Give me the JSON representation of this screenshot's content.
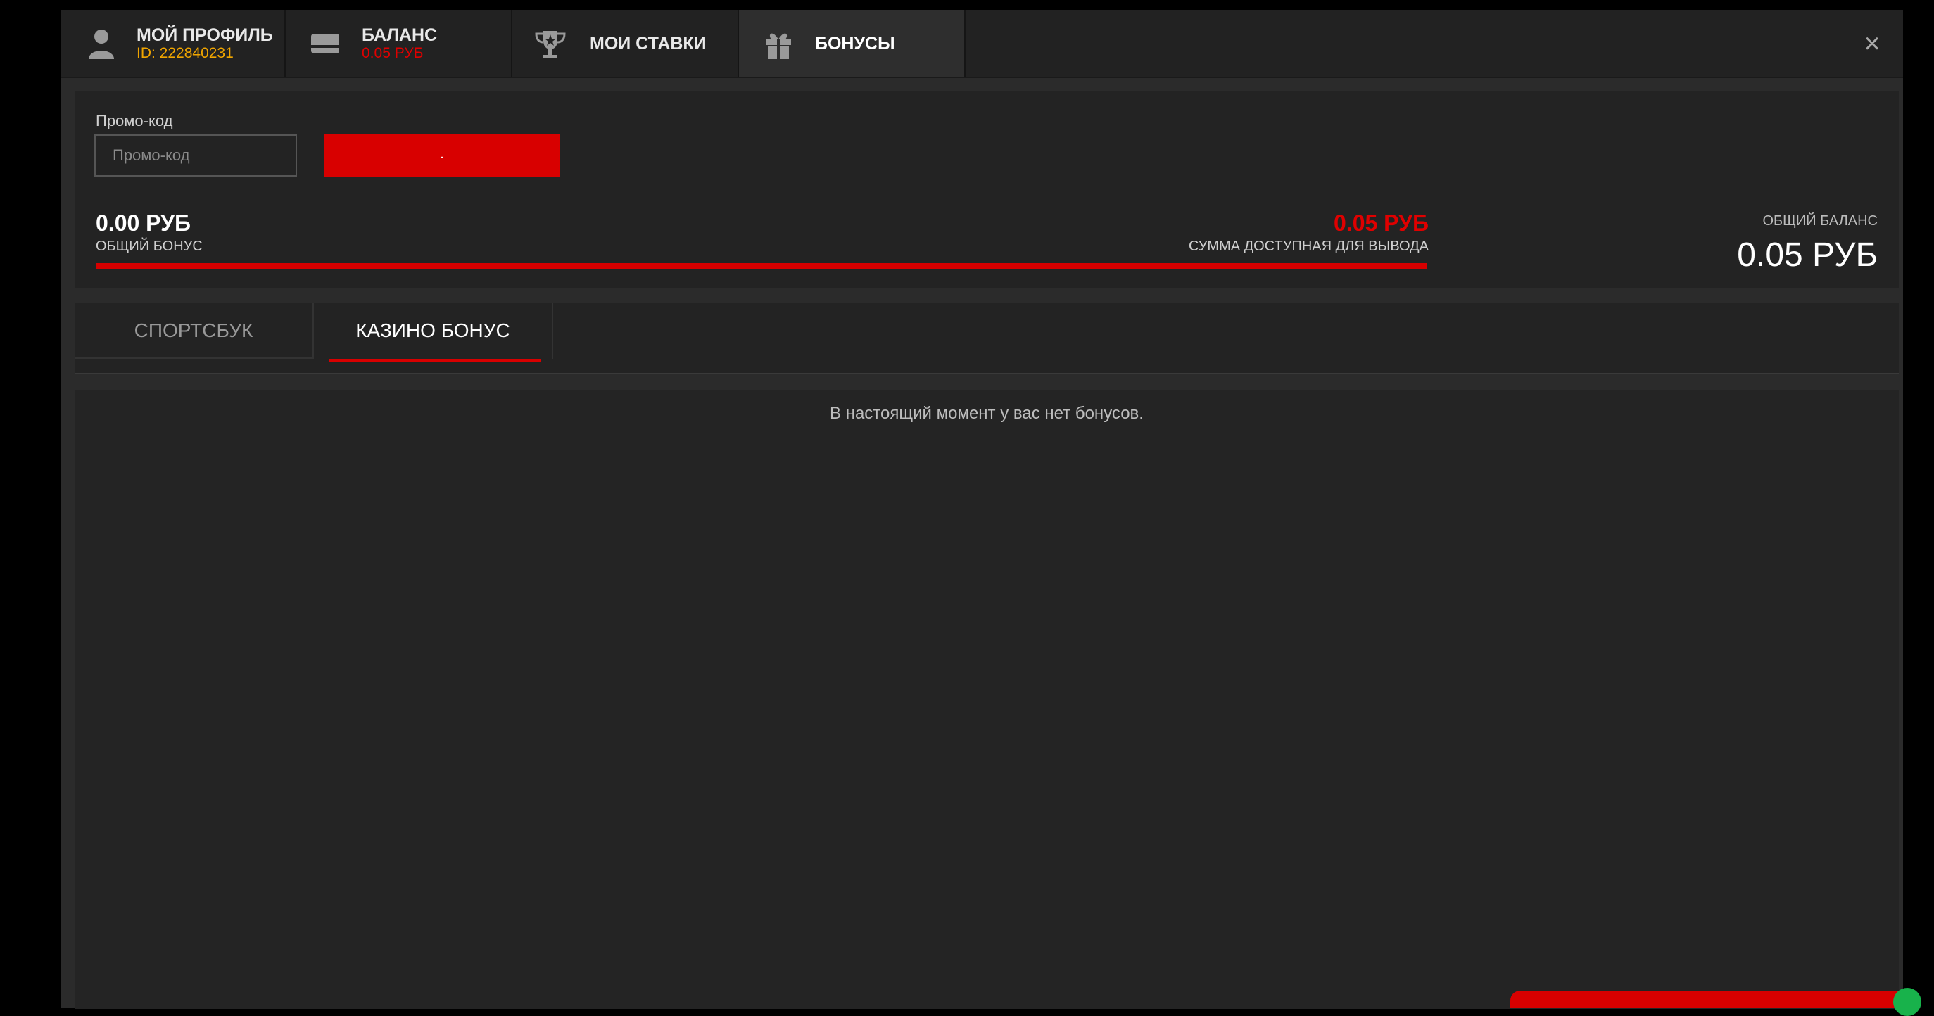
{
  "tabs": [
    {
      "title": "МОЙ ПРОФИЛЬ",
      "subtitle": "ID: 222840231",
      "icon": "user-icon",
      "subtitle_color": "#f0a500"
    },
    {
      "title": "БАЛАНС",
      "subtitle": "0.05 РУБ",
      "icon": "wallet-icon",
      "subtitle_color": "#e00000"
    },
    {
      "title": "МОИ СТАВКИ",
      "icon": "trophy-icon"
    },
    {
      "title": "БОНУСЫ",
      "icon": "gift-icon",
      "active": true
    }
  ],
  "close_label": "×",
  "promo": {
    "label": "Промо-код",
    "placeholder": "Промо-код",
    "button_label": "."
  },
  "summary": {
    "bonus_amount": "0.00 РУБ",
    "bonus_label": "ОБЩИЙ БОНУС",
    "withdraw_amount": "0.05 РУБ",
    "withdraw_label": "СУММА ДОСТУПНАЯ ДЛЯ ВЫВОДА",
    "progress_fraction": 1.0,
    "total_label": "ОБЩИЙ БАЛАНС",
    "total_amount": "0.05 РУБ"
  },
  "subtabs": [
    {
      "label": "СПОРТСБУК",
      "active": false
    },
    {
      "label": "КАЗИНО БОНУС",
      "active": true
    }
  ],
  "content": {
    "empty_message": "В настоящий момент у вас нет бонусов."
  },
  "colors": {
    "accent_red": "#d80000",
    "id_orange": "#f0a500"
  }
}
